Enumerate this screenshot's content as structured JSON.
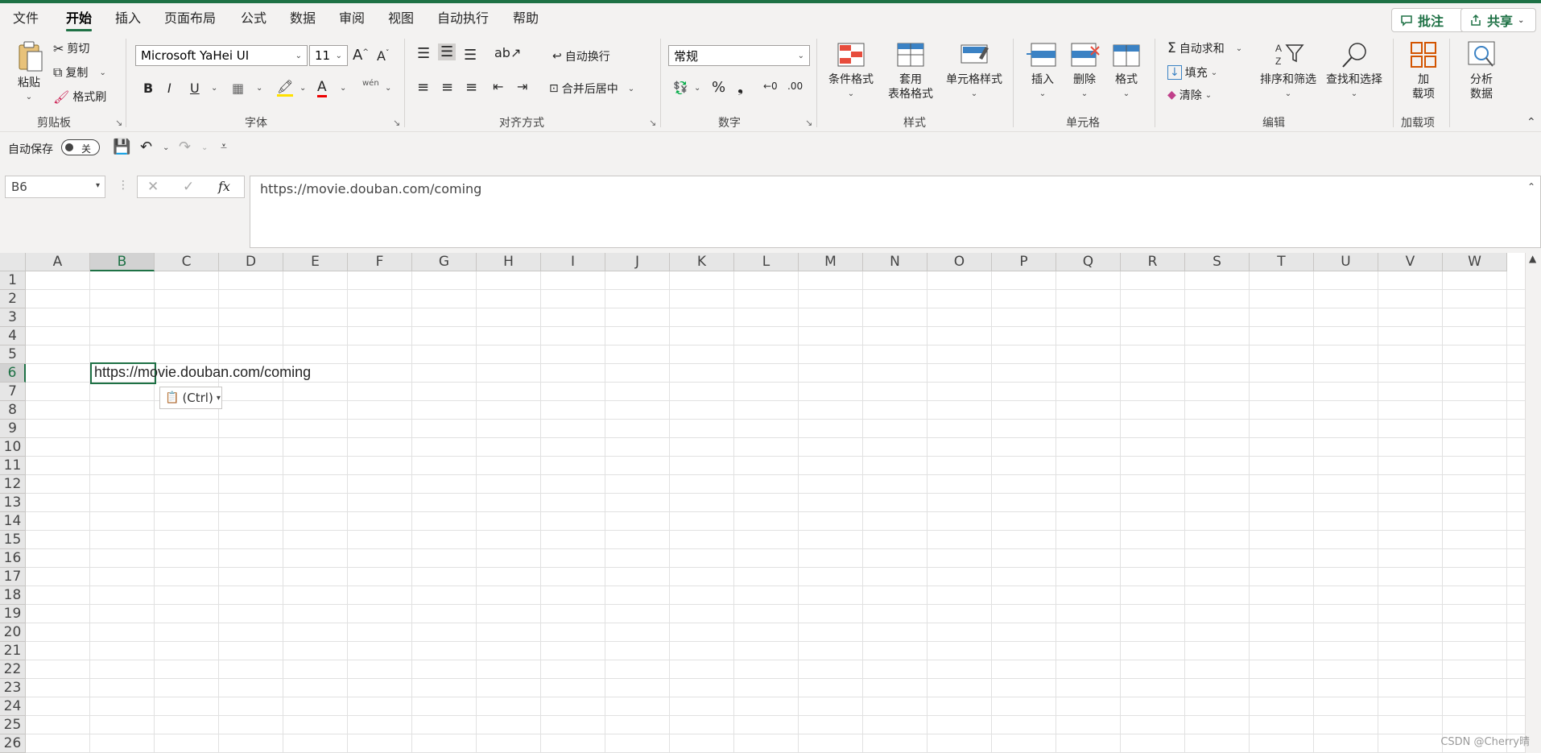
{
  "menu": {
    "tabs": [
      "文件",
      "开始",
      "插入",
      "页面布局",
      "公式",
      "数据",
      "审阅",
      "视图",
      "自动执行",
      "帮助"
    ],
    "active": "开始",
    "comment_label": "批注",
    "share_label": "共享"
  },
  "ribbon": {
    "clipboard": {
      "paste": "粘贴",
      "cut": "剪切",
      "copy": "复制",
      "format_painter": "格式刷",
      "label": "剪贴板"
    },
    "font": {
      "family": "Microsoft YaHei UI",
      "size": "11",
      "bold": "B",
      "italic": "I",
      "underline": "U",
      "phonetic": "wén",
      "label": "字体"
    },
    "alignment": {
      "wrap": "自动换行",
      "merge": "合并后居中",
      "label": "对齐方式"
    },
    "number": {
      "format": "常规",
      "label": "数字"
    },
    "styles": {
      "conditional": "条件格式",
      "table_format_1": "套用",
      "table_format_2": "表格格式",
      "cell_styles": "单元格样式",
      "label": "样式"
    },
    "cells": {
      "insert": "插入",
      "delete": "删除",
      "format": "格式",
      "label": "单元格"
    },
    "editing": {
      "autosum": "自动求和",
      "fill": "填充",
      "clear": "清除",
      "sort": "排序和筛选",
      "find": "查找和选择",
      "label": "编辑"
    },
    "addins": {
      "addin_1": "加",
      "addin_2": "载项",
      "label": "加载项"
    },
    "analyze": {
      "line1": "分析",
      "line2": "数据"
    }
  },
  "qat": {
    "autosave": "自动保存",
    "toggle": "关"
  },
  "formula_bar": {
    "name_box": "B6",
    "fx": "fx",
    "content": "https://movie.douban.com/coming"
  },
  "sheet": {
    "columns": [
      "A",
      "B",
      "C",
      "D",
      "E",
      "F",
      "G",
      "H",
      "I",
      "J",
      "K",
      "L",
      "M",
      "N",
      "O",
      "P",
      "Q",
      "R",
      "S",
      "T",
      "U",
      "V",
      "W"
    ],
    "rows": [
      "1",
      "2",
      "3",
      "4",
      "5",
      "6",
      "7",
      "8",
      "9",
      "10",
      "11",
      "12",
      "13",
      "14",
      "15",
      "16",
      "17",
      "18",
      "19",
      "20",
      "21",
      "22",
      "23",
      "24",
      "25",
      "26"
    ],
    "selected_col": "B",
    "selected_row": "6",
    "cell_b6": "https://movie.douban.com/coming",
    "paste_options": "(Ctrl)"
  },
  "watermark": "CSDN @Cherry晴",
  "colors": {
    "accent": "#1e7145"
  }
}
